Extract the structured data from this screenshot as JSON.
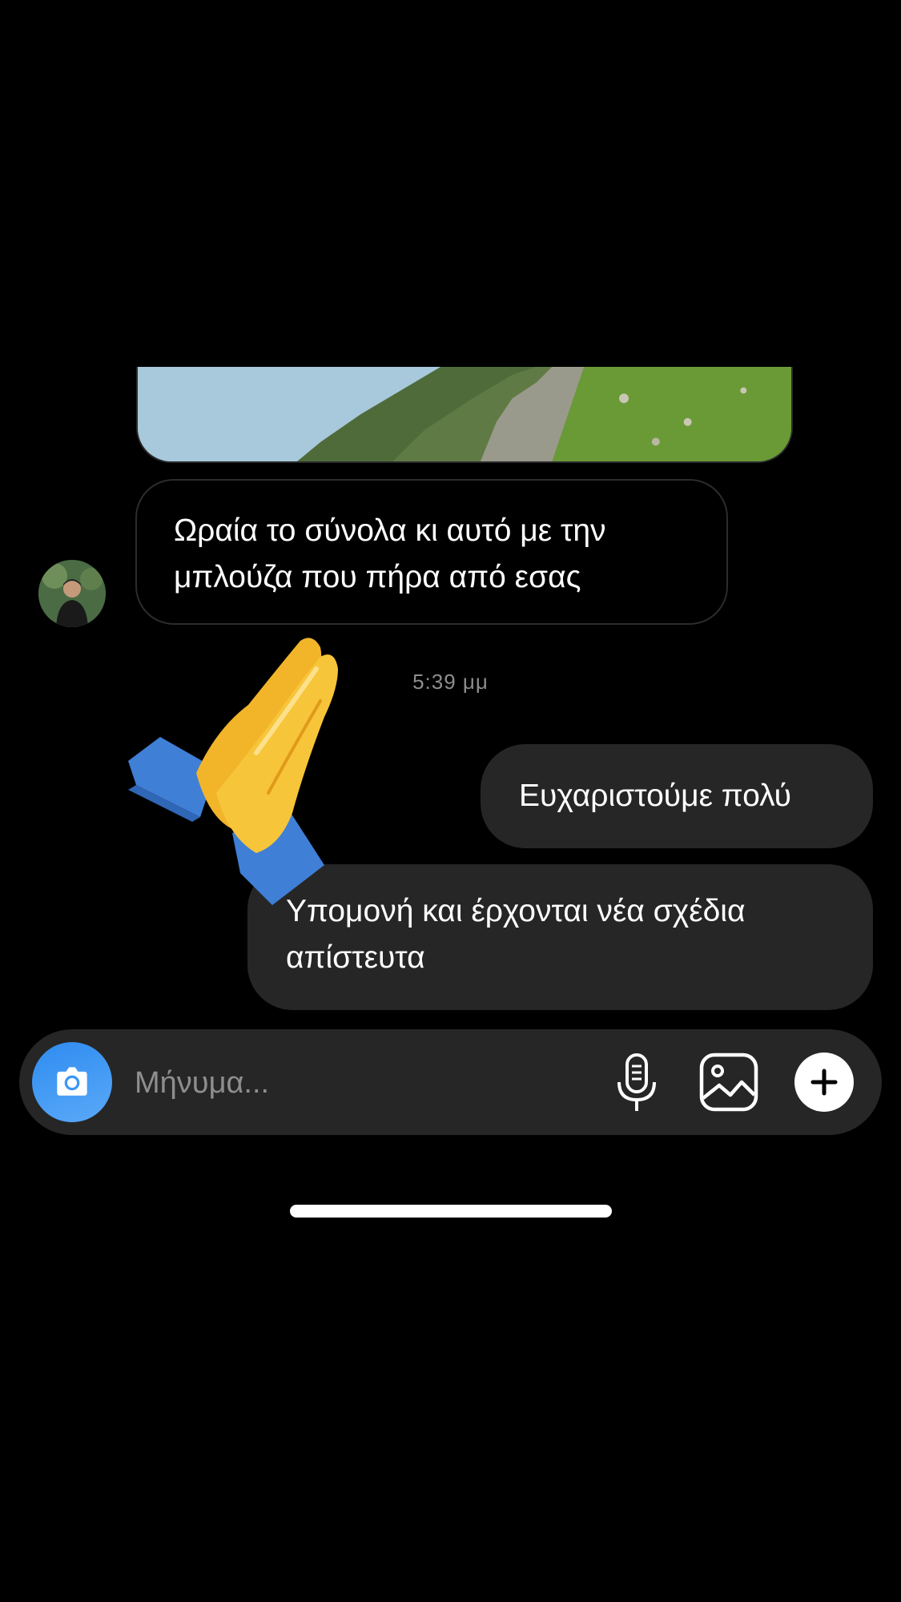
{
  "conversation": {
    "incoming_message": "Ωραία το σύνολα κι αυτό με την μπλούζα που πήρα από εσας",
    "timestamp": "5:39 μμ",
    "outgoing_messages": [
      "Ευχαριστούμε πολύ",
      "Υπομονή και έρχονται νέα σχέδια απίστευτα"
    ],
    "reaction_emoji": "folded-hands"
  },
  "composer": {
    "placeholder": "Μήνυμα...",
    "icons": [
      "camera-icon",
      "microphone-icon",
      "gallery-icon",
      "plus-icon"
    ],
    "accent": "#3b96f4"
  },
  "colors": {
    "background": "#000000",
    "outgoing_bubble": "#262626",
    "incoming_border": "#2c2c2c"
  }
}
